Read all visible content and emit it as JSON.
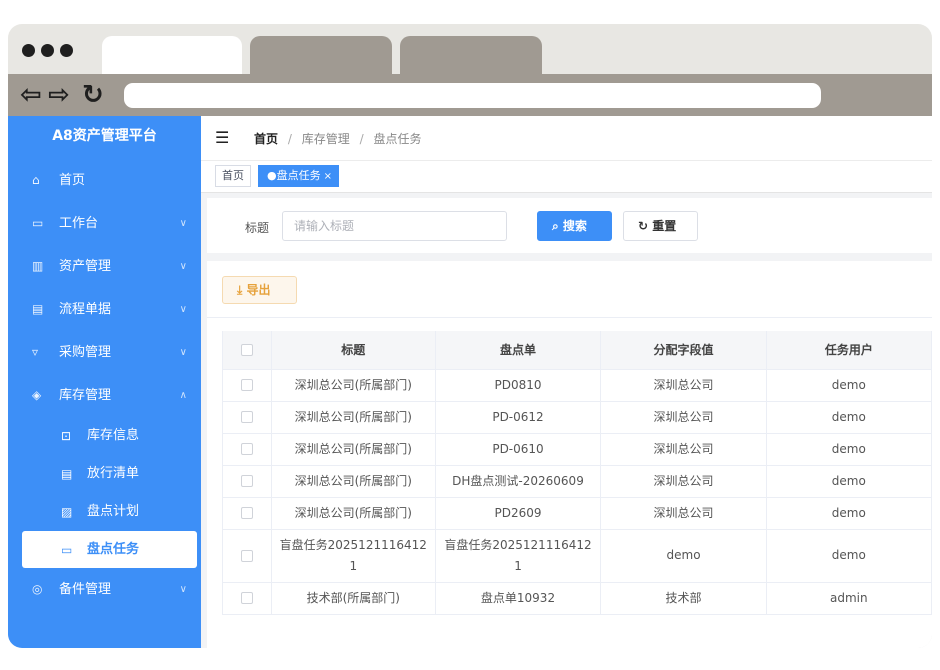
{
  "sidebar": {
    "brand": "A8资产管理平台",
    "items": [
      {
        "label": "首页",
        "icon": "home-icon"
      },
      {
        "label": "工作台",
        "icon": "monitor-icon"
      },
      {
        "label": "资产管理",
        "icon": "building-icon"
      },
      {
        "label": "流程单据",
        "icon": "document-icon"
      },
      {
        "label": "采购管理",
        "icon": "cart-icon"
      },
      {
        "label": "库存管理",
        "icon": "layers-icon"
      },
      {
        "label": "备件管理",
        "icon": "box-icon"
      }
    ],
    "sub_items": [
      {
        "label": "库存信息",
        "icon": "inventory-icon"
      },
      {
        "label": "放行清单",
        "icon": "list-icon"
      },
      {
        "label": "盘点计划",
        "icon": "plan-icon"
      },
      {
        "label": "盘点任务",
        "icon": "task-icon"
      }
    ]
  },
  "header": {
    "breadcrumb": [
      "首页",
      "库存管理",
      "盘点任务"
    ],
    "sep": "/"
  },
  "tags": {
    "home": "首页",
    "active": "●盘点任务",
    "close": "×"
  },
  "search": {
    "label": "标题",
    "placeholder": "请输入标题",
    "search_button": "搜索",
    "reset_button": "重置"
  },
  "toolbar": {
    "export_button": "导出"
  },
  "table": {
    "columns": [
      "标题",
      "盘点单",
      "分配字段值",
      "任务用户"
    ],
    "rows": [
      [
        "深圳总公司(所属部门)",
        "PD0810",
        "深圳总公司",
        "demo"
      ],
      [
        "深圳总公司(所属部门)",
        "PD-0612",
        "深圳总公司",
        "demo"
      ],
      [
        "深圳总公司(所属部门)",
        "PD-0610",
        "深圳总公司",
        "demo"
      ],
      [
        "深圳总公司(所属部门)",
        "DH盘点测试-20260609",
        "深圳总公司",
        "demo"
      ],
      [
        "深圳总公司(所属部门)",
        "PD2609",
        "深圳总公司",
        "demo"
      ],
      [
        "盲盘任务20251211164121",
        "盲盘任务20251211164121",
        "demo",
        "demo"
      ],
      [
        "技术部(所属部门)",
        "盘点单10932",
        "技术部",
        "admin"
      ]
    ]
  },
  "colors": {
    "primary": "#3d8ff7",
    "warning": "#e6a23c",
    "browser_chrome": "#a09a92"
  }
}
